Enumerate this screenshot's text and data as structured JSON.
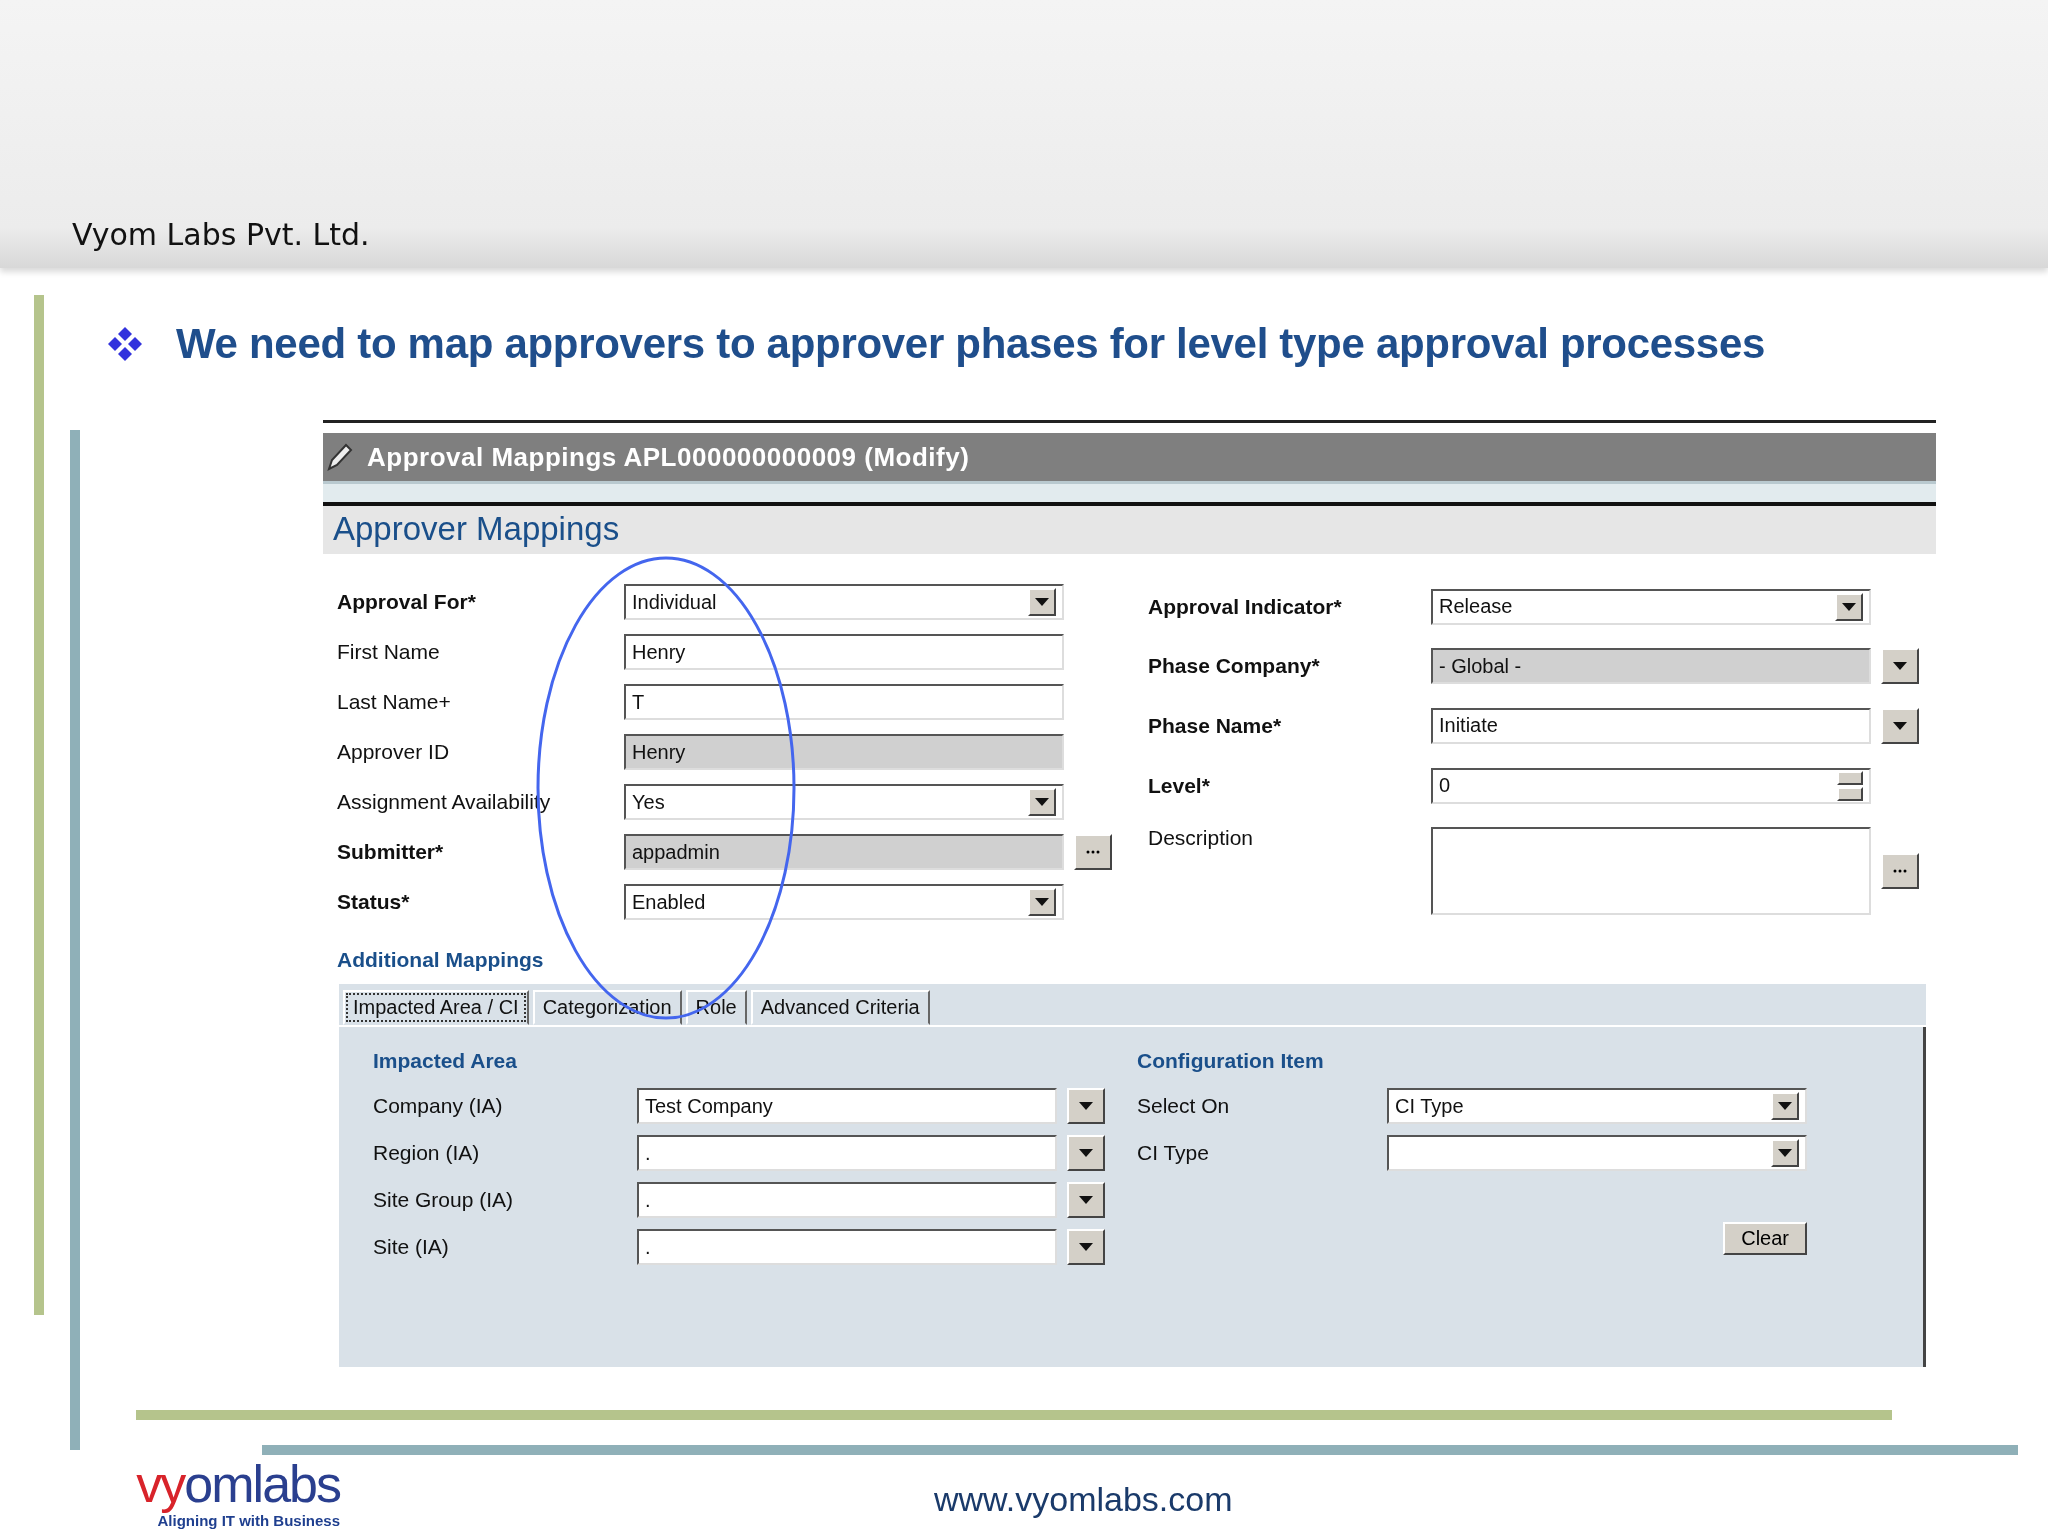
{
  "header": {
    "company": "Vyom Labs Pvt. Ltd."
  },
  "bullet": {
    "text": "We need to map approvers to approver phases for level type approval processes"
  },
  "window": {
    "title": "Approval Mappings APL000000000009 (Modify)"
  },
  "section_title": "Approver Mappings",
  "left_fields": [
    {
      "label": "Approval For*",
      "required": true,
      "kind": "select",
      "locked": false,
      "browse": false,
      "value": "Individual"
    },
    {
      "label": "First Name",
      "required": false,
      "kind": "text",
      "locked": false,
      "browse": false,
      "value": "Henry"
    },
    {
      "label": "Last Name+",
      "required": false,
      "kind": "text",
      "locked": false,
      "browse": false,
      "value": "T"
    },
    {
      "label": "Approver ID",
      "required": false,
      "kind": "text",
      "locked": true,
      "browse": false,
      "value": "Henry"
    },
    {
      "label": "Assignment Availability",
      "required": false,
      "kind": "select",
      "locked": false,
      "browse": false,
      "value": "Yes"
    },
    {
      "label": "Submitter*",
      "required": true,
      "kind": "text",
      "locked": true,
      "browse": true,
      "value": "appadmin"
    },
    {
      "label": "Status*",
      "required": true,
      "kind": "select",
      "locked": false,
      "browse": false,
      "value": "Enabled"
    }
  ],
  "right_fields": [
    {
      "label": "Approval Indicator*",
      "required": true,
      "kind": "select",
      "locked": false,
      "browse": false,
      "value": "Release"
    },
    {
      "label": "Phase Company*",
      "required": true,
      "kind": "combo",
      "locked": true,
      "browse": false,
      "value": "- Global -"
    },
    {
      "label": "Phase Name*",
      "required": true,
      "kind": "combo",
      "locked": false,
      "browse": false,
      "value": "Initiate"
    },
    {
      "label": "Level*",
      "required": true,
      "kind": "spinner",
      "locked": false,
      "browse": false,
      "value": "0"
    },
    {
      "label": "Description",
      "required": false,
      "kind": "textarea",
      "locked": false,
      "browse": true
    }
  ],
  "additional_title": "Additional Mappings",
  "tabs": [
    {
      "label": "Impacted Area / CI",
      "selected": true
    },
    {
      "label": "Categorization",
      "selected": false
    },
    {
      "label": "Role",
      "selected": false
    },
    {
      "label": "Advanced Criteria",
      "selected": false
    }
  ],
  "impacted_area": {
    "title": "Impacted Area",
    "fields": [
      {
        "label": "Company (IA)",
        "kind": "combo",
        "value": "Test Company"
      },
      {
        "label": "Region (IA)",
        "kind": "combo",
        "value": "."
      },
      {
        "label": "Site Group (IA)",
        "kind": "combo",
        "value": "."
      },
      {
        "label": "Site (IA)",
        "kind": "combo",
        "value": "."
      }
    ]
  },
  "configuration_item": {
    "title": "Configuration Item",
    "fields": [
      {
        "label": "Select On",
        "kind": "select",
        "value": "CI Type"
      },
      {
        "label": "CI Type",
        "kind": "select"
      }
    ]
  },
  "clear_button": "Clear",
  "footer": {
    "logo": "vyomlabs",
    "tagline": "Aligning IT with Business",
    "url": "www.vyomlabs.com"
  }
}
